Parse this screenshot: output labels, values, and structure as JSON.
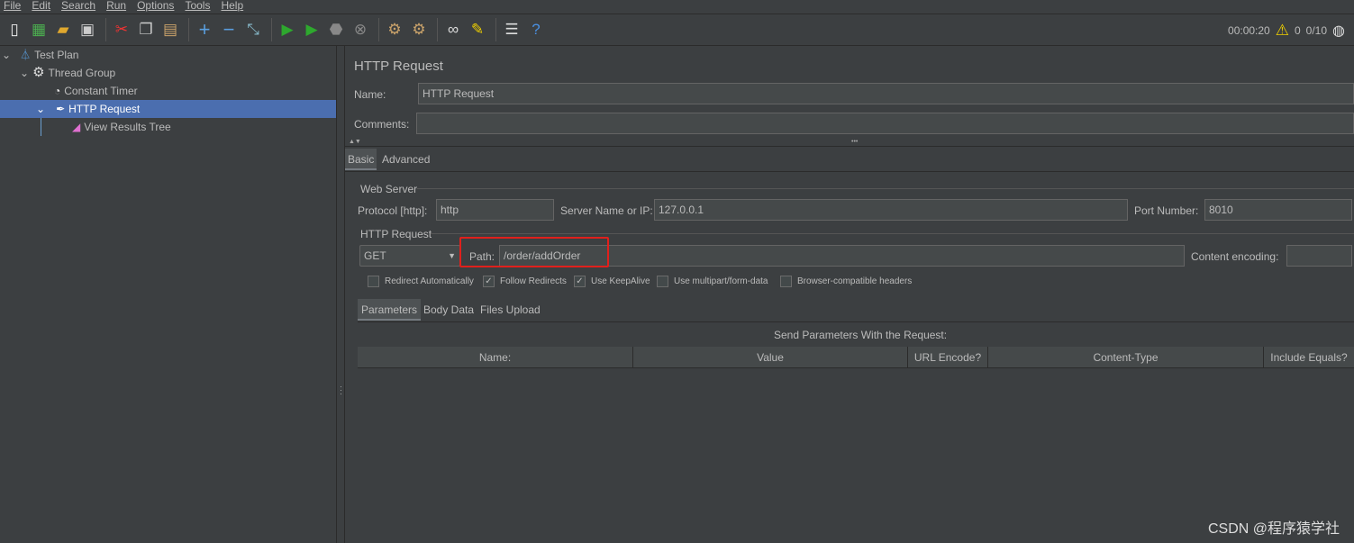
{
  "menu": [
    "File",
    "Edit",
    "Search",
    "Run",
    "Options",
    "Tools",
    "Help"
  ],
  "toolbar": {
    "icons": [
      "new-icon",
      "templates-icon",
      "open-icon",
      "save-icon",
      "cut-icon",
      "copy-icon",
      "paste-icon",
      "expand-icon",
      "collapse-icon",
      "toggle-icon",
      "start-icon",
      "start-no-pause-icon",
      "stop-icon",
      "shutdown-icon",
      "clear-icon",
      "clear-all-icon",
      "search-icon",
      "reset-search-icon",
      "function-helper-icon",
      "help-icon"
    ]
  },
  "status": {
    "elapsed": "00:00:20",
    "warnings": "0",
    "threads": "0/10"
  },
  "tree": {
    "items": [
      {
        "label": "Test Plan"
      },
      {
        "label": "Thread Group"
      },
      {
        "label": "Constant Timer"
      },
      {
        "label": "HTTP Request"
      },
      {
        "label": "View Results Tree"
      }
    ]
  },
  "panel": {
    "title": "HTTP Request",
    "name_label": "Name:",
    "name_value": "HTTP Request",
    "comments_label": "Comments:",
    "comments_value": "",
    "tabs": [
      "Basic",
      "Advanced"
    ],
    "web_server": {
      "legend": "Web Server",
      "protocol_label": "Protocol [http]:",
      "protocol": "http",
      "server_label": "Server Name or IP:",
      "server": "127.0.0.1",
      "port_label": "Port Number:",
      "port": "8010"
    },
    "http_request": {
      "legend": "HTTP Request",
      "method": "GET",
      "path_label": "Path:",
      "path": "/order/addOrder",
      "encoding_label": "Content encoding:",
      "encoding": ""
    },
    "checkboxes": [
      {
        "label": "Redirect Automatically",
        "checked": false
      },
      {
        "label": "Follow Redirects",
        "checked": true
      },
      {
        "label": "Use KeepAlive",
        "checked": true
      },
      {
        "label": "Use multipart/form-data",
        "checked": false
      },
      {
        "label": "Browser-compatible headers",
        "checked": false
      }
    ],
    "param_tabs": [
      "Parameters",
      "Body Data",
      "Files Upload"
    ],
    "params_caption": "Send Parameters With the Request:",
    "columns": [
      "Name:",
      "Value",
      "URL Encode?",
      "Content-Type",
      "Include Equals?"
    ]
  },
  "watermark": "CSDN @程序猿学社",
  "colors": {
    "background": "#3c3f41",
    "selection": "#4b6eaf",
    "highlight": "#e0201c"
  }
}
